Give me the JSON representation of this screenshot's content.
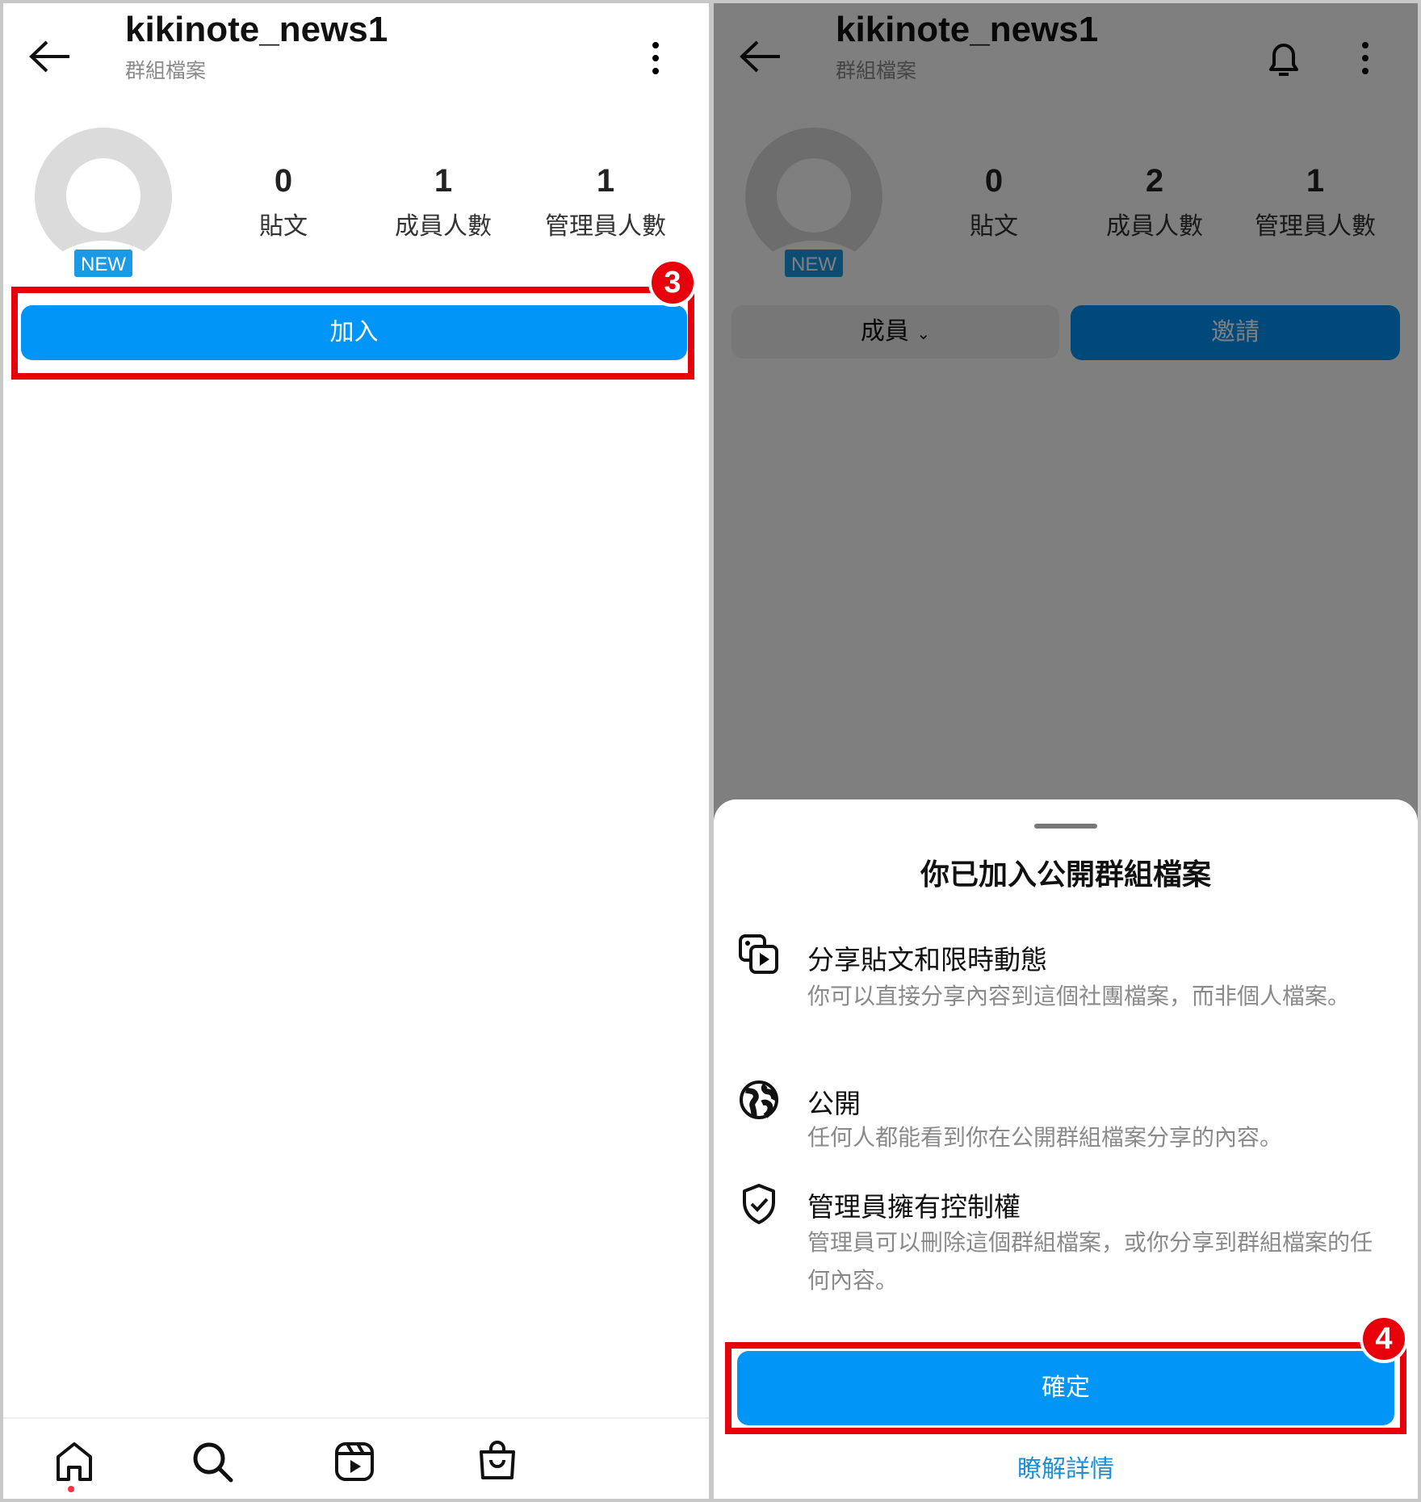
{
  "left": {
    "header": {
      "title": "kikinote_news1",
      "subtitle": "群組檔案"
    },
    "badge": "NEW",
    "stats": [
      {
        "value": "0",
        "label": "貼文"
      },
      {
        "value": "1",
        "label": "成員人數"
      },
      {
        "value": "1",
        "label": "管理員人數"
      }
    ],
    "join_button": "加入",
    "step": "3",
    "nav": [
      "home-icon",
      "search-icon",
      "reels-icon",
      "shop-icon"
    ]
  },
  "right": {
    "header": {
      "title": "kikinote_news1",
      "subtitle": "群組檔案"
    },
    "badge": "NEW",
    "stats": [
      {
        "value": "0",
        "label": "貼文"
      },
      {
        "value": "2",
        "label": "成員人數"
      },
      {
        "value": "1",
        "label": "管理員人數"
      }
    ],
    "member_dropdown": "成員",
    "invite_button": "邀請",
    "sheet": {
      "title": "你已加入公開群組檔案",
      "items": [
        {
          "icon": "media-share-icon",
          "title": "分享貼文和限時動態",
          "desc": "你可以直接分享內容到這個社團檔案，而非個人檔案。"
        },
        {
          "icon": "globe-icon",
          "title": "公開",
          "desc": "任何人都能看到你在公開群組檔案分享的內容。"
        },
        {
          "icon": "shield-check-icon",
          "title": "管理員擁有控制權",
          "desc": "管理員可以刪除這個群組檔案，或你分享到群組檔案的任何內容。"
        }
      ],
      "confirm_button": "確定",
      "learn_more": "瞭解詳情"
    },
    "step": "4"
  },
  "colors": {
    "accent": "#0095f6",
    "highlight": "#e8000b"
  }
}
